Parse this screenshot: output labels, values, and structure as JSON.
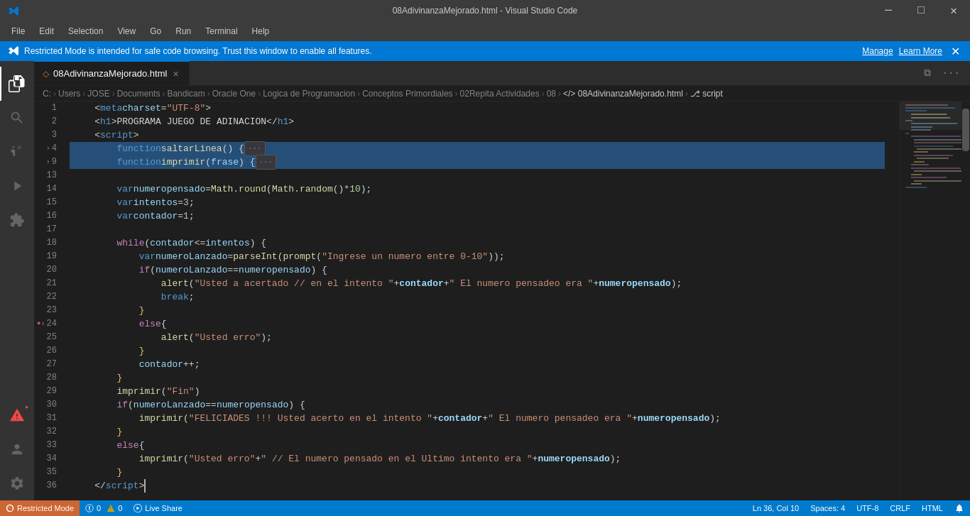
{
  "titleBar": {
    "title": "08AdivinanzaMejorado.html - Visual Studio Code",
    "minimize": "─",
    "maximize": "□",
    "restore": "❐",
    "close": "✕"
  },
  "menuBar": {
    "items": [
      "File",
      "Edit",
      "Selection",
      "View",
      "Go",
      "Run",
      "Terminal",
      "Help"
    ]
  },
  "notification": {
    "text": "Restricted Mode is intended for safe code browsing. Trust this window to enable all features.",
    "manageLabel": "Manage",
    "learnMoreLabel": "Learn More"
  },
  "tab": {
    "icon": "◇",
    "filename": "08AdivinanzaMejorado.html",
    "closeIcon": "×"
  },
  "breadcrumb": {
    "items": [
      "C:",
      "Users",
      "JOSE",
      "Documents",
      "Bandicam",
      "Oracle One",
      "Logica de Programacion",
      "Conceptos Primordiales",
      "02Repita Actividades",
      "08",
      "⟨⟩ 08AdivinanzaMejorado.html",
      "⎇ script"
    ],
    "separator": "›"
  },
  "statusBar": {
    "restrictedMode": "Restricted Mode",
    "errors": "0",
    "warnings": "0",
    "liveShare": "Live Share",
    "lineCol": "Ln 36, Col 10",
    "spaces": "Spaces: 4",
    "encoding": "UTF-8",
    "lineEnding": "CRLF",
    "language": "HTML",
    "notifications": "🔔"
  },
  "activityBar": {
    "icons": [
      {
        "name": "explorer-icon",
        "symbol": "⎘",
        "active": true
      },
      {
        "name": "search-icon",
        "symbol": "🔍",
        "active": false
      },
      {
        "name": "source-control-icon",
        "symbol": "⑂",
        "active": false
      },
      {
        "name": "run-debug-icon",
        "symbol": "▷",
        "active": false
      },
      {
        "name": "extensions-icon",
        "symbol": "⊞",
        "active": false
      },
      {
        "name": "error-icon",
        "symbol": "⚠",
        "active": false,
        "hasError": true
      },
      {
        "name": "account-icon",
        "symbol": "👤",
        "active": false,
        "bottom": true
      },
      {
        "name": "settings-icon",
        "symbol": "⚙",
        "active": false,
        "bottom": true
      }
    ]
  },
  "codeLines": [
    {
      "num": 1,
      "content": "meta_line"
    },
    {
      "num": 2,
      "content": "h1_line"
    },
    {
      "num": 3,
      "content": "script_open"
    },
    {
      "num": 4,
      "content": "fn_saltarLinea",
      "folded": true,
      "selected": true
    },
    {
      "num": 9,
      "content": "fn_imprimir",
      "folded": true,
      "selected": true
    },
    {
      "num": 13,
      "content": "empty"
    },
    {
      "num": 14,
      "content": "var_numeropensado"
    },
    {
      "num": 15,
      "content": "var_intentos"
    },
    {
      "num": 16,
      "content": "var_contador"
    },
    {
      "num": 17,
      "content": "empty"
    },
    {
      "num": 18,
      "content": "while_start"
    },
    {
      "num": 19,
      "content": "var_numeroLanzado"
    },
    {
      "num": 20,
      "content": "if_numLanzado"
    },
    {
      "num": 21,
      "content": "alert_acertado"
    },
    {
      "num": 22,
      "content": "break"
    },
    {
      "num": 23,
      "content": "close_brace1"
    },
    {
      "num": 24,
      "content": "else_start",
      "hasBreakpoint": true,
      "folded": true
    },
    {
      "num": 25,
      "content": "alert_erro"
    },
    {
      "num": 26,
      "content": "close_brace2"
    },
    {
      "num": 27,
      "content": "contador_inc"
    },
    {
      "num": 28,
      "content": "close_brace3"
    },
    {
      "num": 29,
      "content": "imprimir_fin"
    },
    {
      "num": 30,
      "content": "if_numLanzado2"
    },
    {
      "num": 31,
      "content": "imprimir_feliciades"
    },
    {
      "num": 32,
      "content": "close_brace4"
    },
    {
      "num": 33,
      "content": "else_start2"
    },
    {
      "num": 34,
      "content": "imprimir_usted_erro"
    },
    {
      "num": 35,
      "content": "close_brace5"
    },
    {
      "num": 36,
      "content": "script_close"
    }
  ]
}
